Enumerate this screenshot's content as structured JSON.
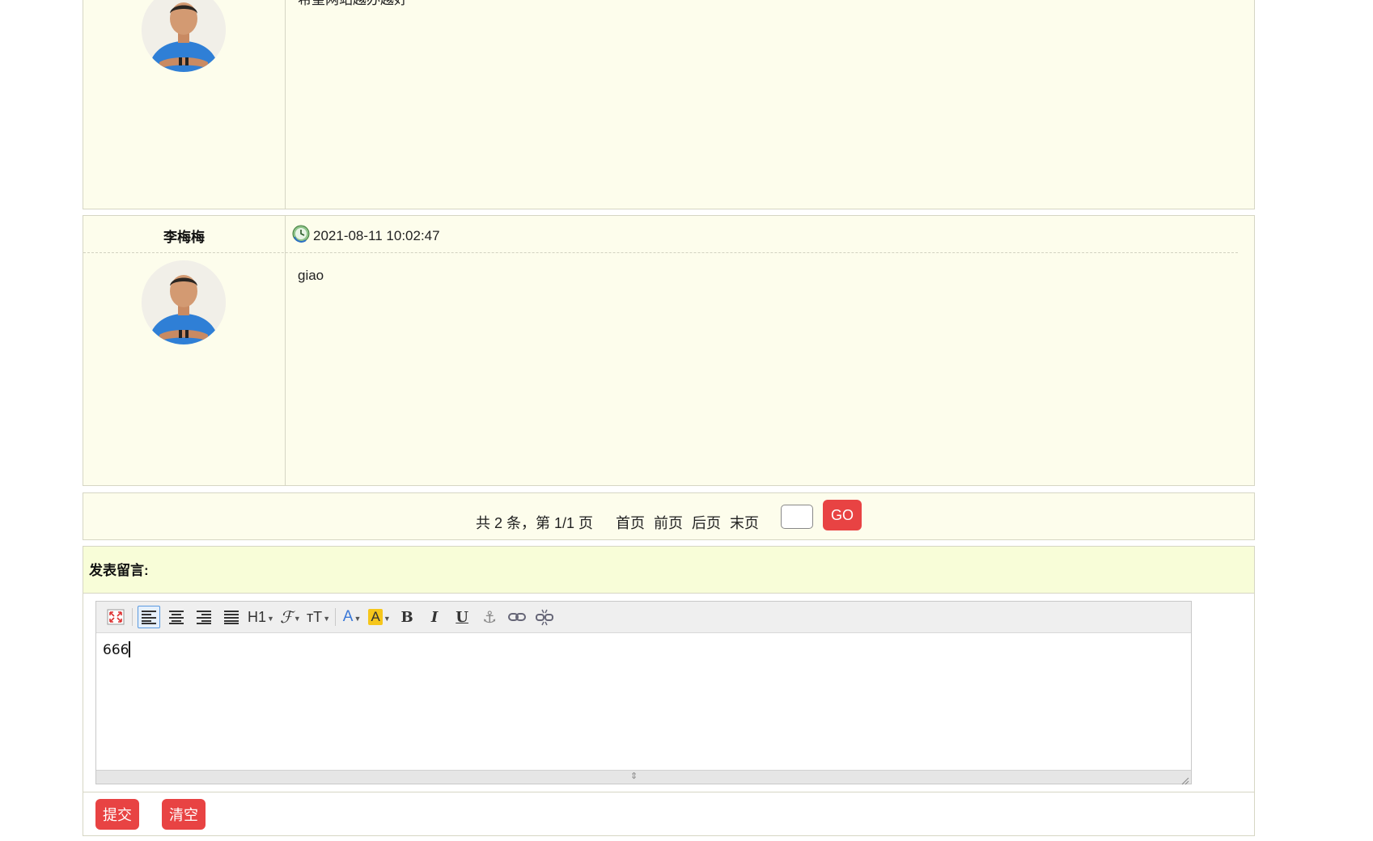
{
  "comments": [
    {
      "author": "",
      "time": "",
      "content": "希望网站越办越好"
    },
    {
      "author": "李梅梅",
      "time": "2021-08-11 10:02:47",
      "content": "giao"
    }
  ],
  "pagination": {
    "summary": "共 2 条，第 1/1 页",
    "first": "首页",
    "prev": "前页",
    "next": "后页",
    "last": "末页",
    "page_input": "",
    "go_label": "GO"
  },
  "post": {
    "header": "发表留言:",
    "editor_text": "666",
    "submit_label": "提交",
    "clear_label": "清空",
    "toolbar": {
      "heading_label": "H1",
      "font_size_label": "тT",
      "bold_label": "B",
      "italic_label": "I",
      "underline_label": "U",
      "font_color_label": "A",
      "highlight_label": "A"
    }
  },
  "colors": {
    "button_red": "#e84343",
    "row_background": "#fdfdec",
    "header_background": "#f8fdd8",
    "border": "#d6d6c4"
  }
}
